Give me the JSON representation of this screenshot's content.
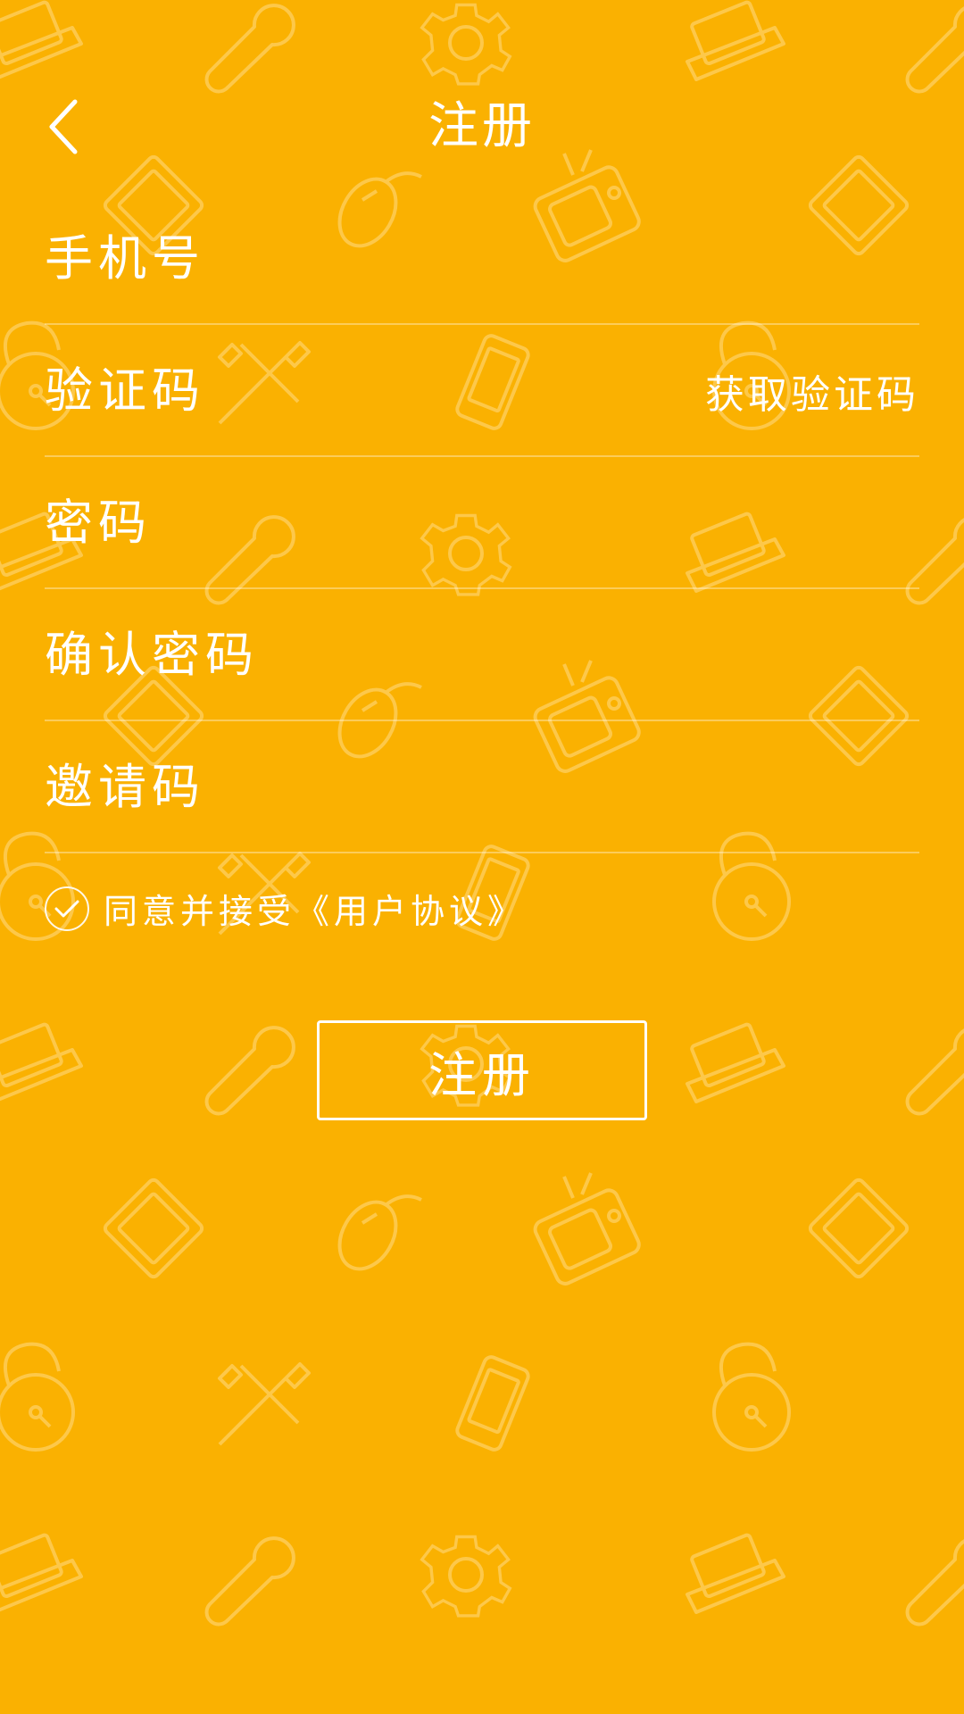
{
  "header": {
    "title": "注册",
    "back_icon": "chevron-left-icon"
  },
  "form": {
    "phone_placeholder": "手机号",
    "code_placeholder": "验证码",
    "get_code_label": "获取验证码",
    "password_placeholder": "密码",
    "confirm_password_placeholder": "确认密码",
    "invite_code_placeholder": "邀请码"
  },
  "agreement": {
    "checked": true,
    "check_icon": "checkmark-icon",
    "text": "同意并接受《用户协议》"
  },
  "actions": {
    "register_label": "注册"
  },
  "theme": {
    "background": "#FAB101",
    "foreground": "#FFFFFF",
    "pattern_stroke": "#FDC84A"
  },
  "background_pattern_icons": [
    "laptop-icon",
    "wrench-icon",
    "gear-icon",
    "tablet-icon",
    "mouse-icon",
    "tv-icon",
    "phone-icon",
    "lock-icon",
    "tools-icon"
  ]
}
